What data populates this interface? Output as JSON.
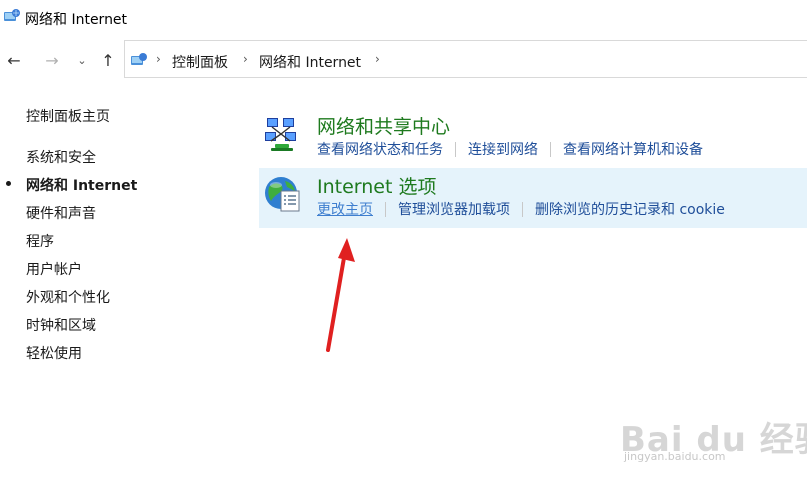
{
  "window": {
    "title": "网络和 Internet"
  },
  "navigation": {
    "back_icon": "←",
    "forward_icon": "→",
    "recent_icon": "⌄",
    "up_icon": "↑",
    "breadcrumb": [
      "控制面板",
      "网络和 Internet"
    ],
    "separator": "›"
  },
  "sidebar": {
    "home": "控制面板主页",
    "items": [
      {
        "label": "系统和安全",
        "active": false
      },
      {
        "label": "网络和 Internet",
        "active": true
      },
      {
        "label": "硬件和声音",
        "active": false
      },
      {
        "label": "程序",
        "active": false
      },
      {
        "label": "用户帐户",
        "active": false
      },
      {
        "label": "外观和个性化",
        "active": false
      },
      {
        "label": "时钟和区域",
        "active": false
      },
      {
        "label": "轻松使用",
        "active": false
      }
    ]
  },
  "categories": [
    {
      "title": "网络和共享中心",
      "icon": "network-sharing-center-icon",
      "links": [
        "查看网络状态和任务",
        "连接到网络",
        "查看网络计算机和设备"
      ]
    },
    {
      "title": "Internet 选项",
      "icon": "internet-options-icon",
      "highlighted": true,
      "links": [
        "更改主页",
        "管理浏览器加载项",
        "删除浏览的历史记录和 cookie"
      ]
    }
  ],
  "colors": {
    "category_title": "#1e7a1e",
    "link": "#1f4e99",
    "highlight_bg": "#e5f3fb",
    "annotation_arrow": "#e02020"
  },
  "watermark": {
    "brand": "Bai du 经验",
    "url": "jingyan.baidu.com"
  }
}
